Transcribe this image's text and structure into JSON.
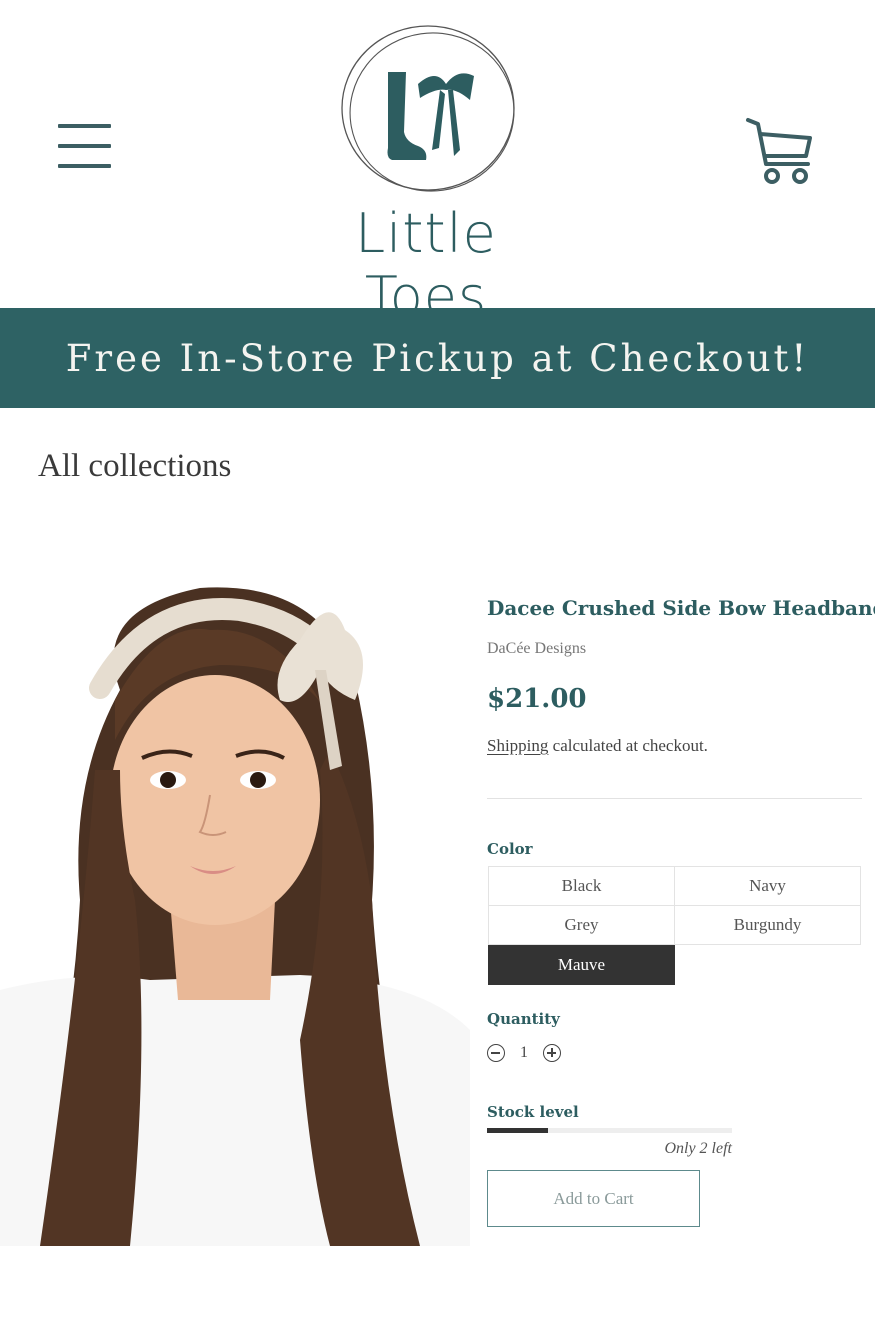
{
  "header": {
    "menu_icon": "hamburger-menu-icon",
    "logo_text": "Little Toes",
    "cart_icon": "shopping-cart-icon"
  },
  "banner": {
    "text": "Free In-Store Pickup at Checkout!"
  },
  "breadcrumb": {
    "label": "All collections"
  },
  "product": {
    "title": "Dacee Crushed Side Bow Headband",
    "vendor": "DaCée Designs",
    "price": "$21.00",
    "shipping_link": "Shipping",
    "shipping_suffix": " calculated at checkout."
  },
  "color": {
    "label": "Color",
    "options": [
      "Black",
      "Navy",
      "Grey",
      "Burgundy",
      "Mauve"
    ],
    "selected": "Mauve"
  },
  "quantity": {
    "label": "Quantity",
    "value": "1"
  },
  "stock": {
    "label": "Stock level",
    "note": "Only 2 left",
    "level_fraction": 0.25
  },
  "add_to_cart": {
    "label": "Add to Cart"
  },
  "colors": {
    "brand_teal": "#2e6264",
    "text_dark": "#333333",
    "selected_swatch": "#333333"
  }
}
